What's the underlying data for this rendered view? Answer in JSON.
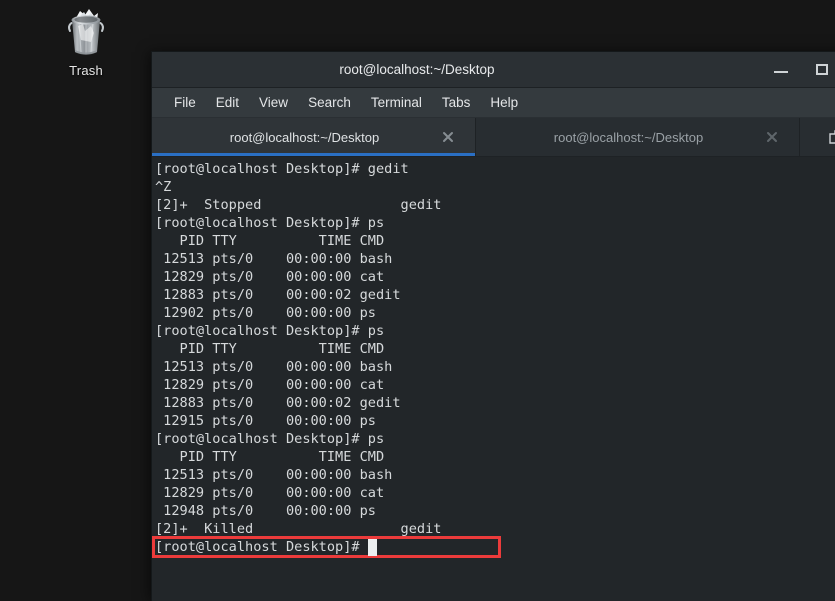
{
  "desktop": {
    "background_color": "#161616",
    "icons": [
      {
        "name": "trash",
        "label": "Trash"
      }
    ]
  },
  "window": {
    "title": "root@localhost:~/Desktop",
    "titlebar_color": "#2b3034",
    "body_color": "#222629",
    "controls": {
      "minimize_label": "Minimize",
      "maximize_label": "Maximize"
    }
  },
  "menubar": {
    "items": [
      {
        "label": "File"
      },
      {
        "label": "Edit"
      },
      {
        "label": "View"
      },
      {
        "label": "Search"
      },
      {
        "label": "Terminal"
      },
      {
        "label": "Tabs"
      },
      {
        "label": "Help"
      }
    ]
  },
  "tabs": {
    "accent_color": "#2a6fc4",
    "new_tab_label": "New Tab",
    "items": [
      {
        "title": "root@localhost:~/Desktop",
        "active": true,
        "close_label": "Close tab"
      },
      {
        "title": "root@localhost:~/Desktop",
        "active": false,
        "close_label": "Close tab"
      }
    ]
  },
  "terminal": {
    "foreground_color": "#d6d9db",
    "background_color": "#222629",
    "cursor": "block",
    "highlight": {
      "color": "#ec3b3b",
      "target_line_index": 21,
      "label": "killed-job-highlight"
    },
    "lines": [
      "[root@localhost Desktop]# gedit",
      "^Z",
      "[2]+  Stopped                 gedit",
      "[root@localhost Desktop]# ps",
      "   PID TTY          TIME CMD",
      " 12513 pts/0    00:00:00 bash",
      " 12829 pts/0    00:00:00 cat",
      " 12883 pts/0    00:00:02 gedit",
      " 12902 pts/0    00:00:00 ps",
      "[root@localhost Desktop]# ps",
      "   PID TTY          TIME CMD",
      " 12513 pts/0    00:00:00 bash",
      " 12829 pts/0    00:00:00 cat",
      " 12883 pts/0    00:00:02 gedit",
      " 12915 pts/0    00:00:00 ps",
      "[root@localhost Desktop]# ps",
      "   PID TTY          TIME CMD",
      " 12513 pts/0    00:00:00 bash",
      " 12829 pts/0    00:00:00 cat",
      " 12948 pts/0    00:00:00 ps",
      "[2]+  Killed                  gedit",
      "[root@localhost Desktop]# "
    ]
  }
}
